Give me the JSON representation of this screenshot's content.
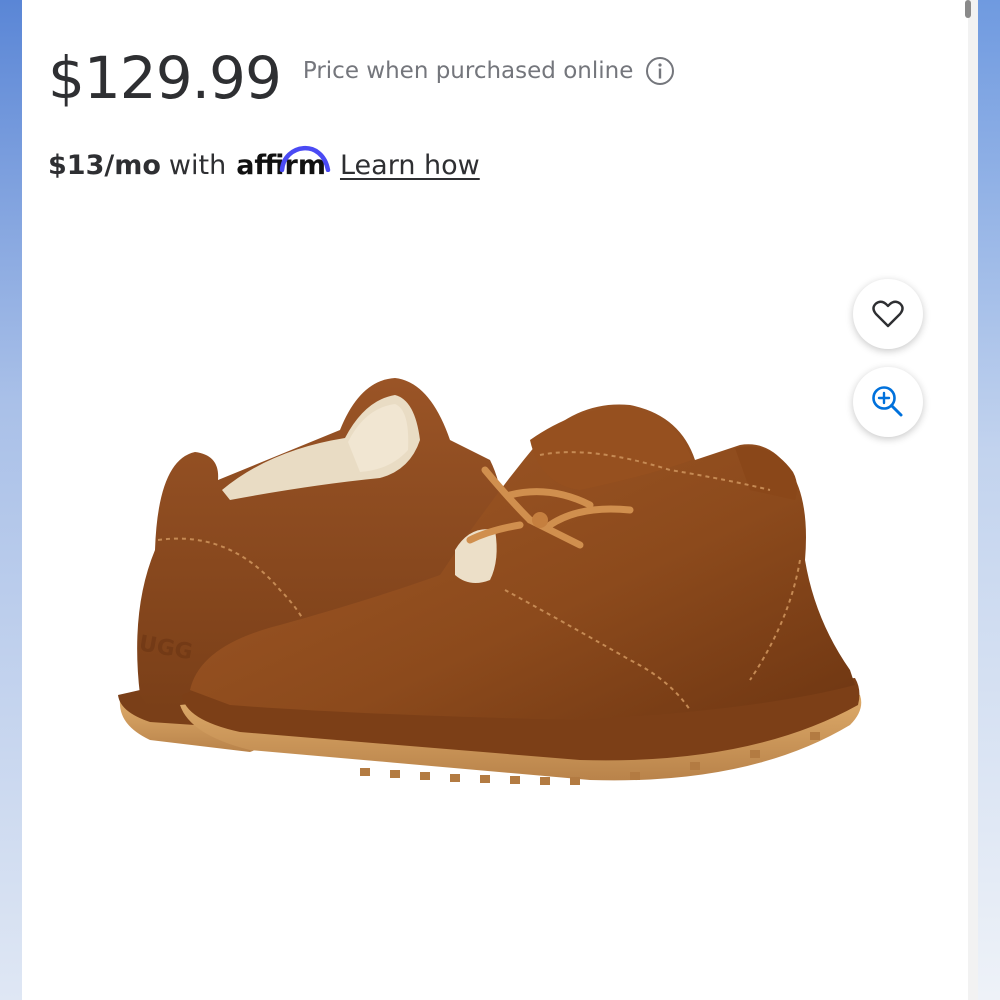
{
  "price": {
    "amount": "$129.99",
    "note": "Price when purchased online"
  },
  "financing": {
    "monthly": "$13/mo",
    "with_text": "with",
    "provider": "affirm",
    "learn_link": "Learn how"
  },
  "product_image": {
    "subject": "brown suede chukka shoes with shearling lining",
    "brand_mark": "UGG"
  },
  "actions": {
    "favorite_icon": "heart-icon",
    "zoom_icon": "zoom-in-icon"
  },
  "colors": {
    "text_primary": "#2e2f32",
    "text_secondary": "#74767c",
    "affirm_arc": "#4a4af4",
    "zoom_icon": "#0071dc",
    "shoe_suede": "#8a4a1f",
    "sole": "#d19a5a"
  }
}
